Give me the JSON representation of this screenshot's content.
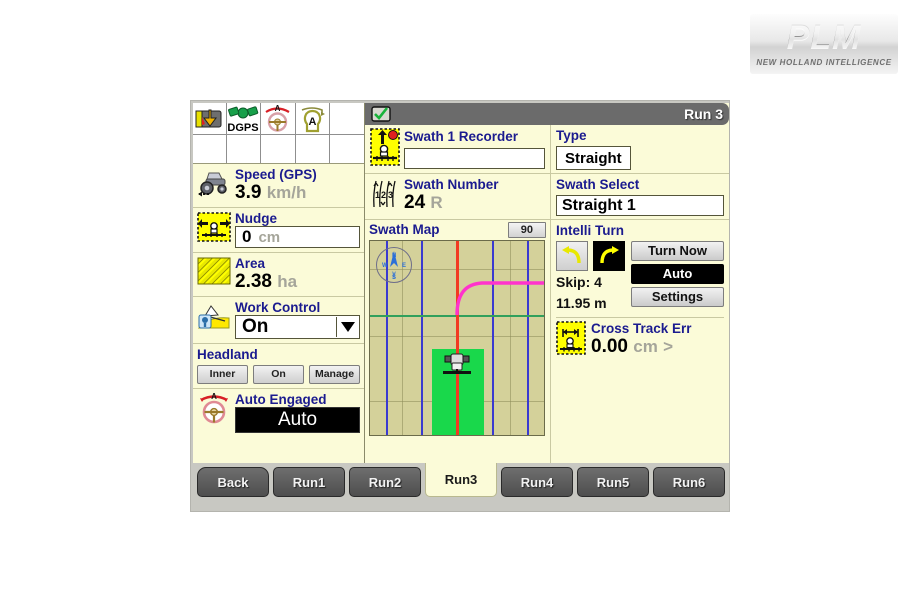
{
  "logo": {
    "brand": "PLM",
    "tagline": "NEW HOLLAND INTELLIGENCE"
  },
  "titlebar": {
    "status_icon": "checkmark-screen-icon",
    "title": "Run 3"
  },
  "status_icons": [
    {
      "name": "implement-lift-icon",
      "label": ""
    },
    {
      "name": "gps-satellite-icon",
      "label": "DGPS"
    },
    {
      "name": "autosteer-wheel-icon",
      "label": ""
    },
    {
      "name": "auto-guidance-bulb-icon",
      "label": "A"
    },
    {
      "name": "empty-cell",
      "label": ""
    }
  ],
  "left_panel": {
    "speed": {
      "icon": "tractor-icon",
      "title": "Speed (GPS)",
      "value": "3.9",
      "unit": "km/h"
    },
    "nudge": {
      "icon": "nudge-icon",
      "title": "Nudge",
      "value": "0",
      "unit": "cm"
    },
    "area": {
      "icon": "area-hatch-icon",
      "title": "Area",
      "value": "2.38",
      "unit": "ha"
    },
    "work_control": {
      "icon": "work-control-icon",
      "title": "Work Control",
      "value": "On",
      "dropdown_icon": "chevron-down-icon"
    },
    "headland": {
      "title": "Headland",
      "buttons": [
        "Inner",
        "On",
        "Manage"
      ]
    },
    "auto_engaged": {
      "icon": "steering-wheel-icon",
      "title": "Auto Engaged",
      "value": "Auto"
    }
  },
  "right_panel": {
    "swath_recorder": {
      "icon": "swath-recorder-icon",
      "title": "Swath 1 Recorder",
      "value": ""
    },
    "type": {
      "title": "Type",
      "value": "Straight"
    },
    "swath_number": {
      "icon": "swath-number-icon",
      "title": "Swath Number",
      "value": "24",
      "side": "R"
    },
    "swath_select": {
      "title": "Swath Select",
      "value": "Straight 1"
    },
    "swath_map": {
      "title": "Swath Map",
      "badge": "90",
      "compass": {
        "n": "N",
        "e": "E",
        "s": "S",
        "w": "W"
      }
    },
    "intelli_turn": {
      "title": "Intelli Turn",
      "turn_left_icon": "turn-left-icon",
      "turn_right_icon": "turn-right-icon",
      "skip_label": "Skip: 4",
      "width_label": "11.95 m",
      "buttons": [
        "Turn Now",
        "Auto",
        "Settings"
      ],
      "selected_button": "Auto"
    },
    "cross_track_err": {
      "icon": "cross-track-icon",
      "title": "Cross Track Err",
      "value": "0.00",
      "unit": "cm",
      "direction": ">"
    }
  },
  "tabs": [
    {
      "label": "Back",
      "active": false
    },
    {
      "label": "Run1",
      "active": false
    },
    {
      "label": "Run2",
      "active": false
    },
    {
      "label": "Run3",
      "active": true
    },
    {
      "label": "Run4",
      "active": false
    },
    {
      "label": "Run5",
      "active": false
    },
    {
      "label": "Run6",
      "active": false
    }
  ],
  "colors": {
    "panel_bg": "#fbfbd8",
    "title_blue": "#1b1b8f",
    "titlebar_gray": "#6b6b6b",
    "map_field": "#d4d19a",
    "map_covered": "#19d84b",
    "map_guideline": "#f23b22",
    "map_swathline": "#3a3ad0",
    "turn_path": "#ff33cc",
    "accent_yellow": "#ffff00"
  }
}
